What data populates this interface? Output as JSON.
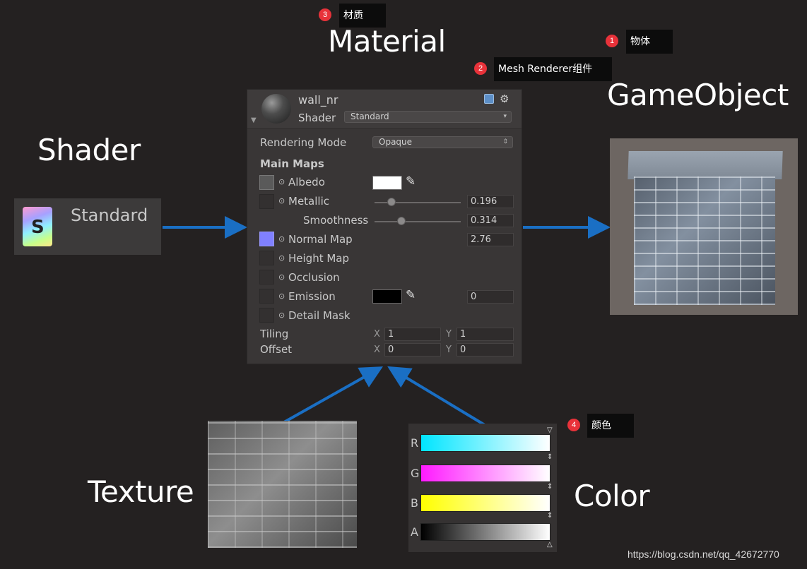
{
  "headings": {
    "material": "Material",
    "gameobject": "GameObject",
    "shader": "Shader",
    "texture": "Texture",
    "color": "Color"
  },
  "callouts": [
    {
      "num": "1",
      "text": "物体"
    },
    {
      "num": "2",
      "text": "Mesh Renderer组件"
    },
    {
      "num": "3",
      "text": "材质"
    },
    {
      "num": "4",
      "text": "颜色"
    }
  ],
  "shader_asset": {
    "icon_letter": "S",
    "name": "Standard"
  },
  "inspector": {
    "material_name": "wall_nr",
    "shader_label": "Shader",
    "shader_value": "Standard",
    "rendering_mode_label": "Rendering Mode",
    "rendering_mode_value": "Opaque",
    "main_maps_label": "Main Maps",
    "albedo_label": "Albedo",
    "metallic_label": "Metallic",
    "metallic_value": "0.196",
    "smoothness_label": "Smoothness",
    "smoothness_value": "0.314",
    "normal_map_label": "Normal Map",
    "normal_map_value": "2.76",
    "height_map_label": "Height Map",
    "occlusion_label": "Occlusion",
    "emission_label": "Emission",
    "emission_value": "0",
    "detail_mask_label": "Detail Mask",
    "tiling_label": "Tiling",
    "offset_label": "Offset",
    "x_label": "X",
    "y_label": "Y",
    "tiling_x": "1",
    "tiling_y": "1",
    "offset_x": "0",
    "offset_y": "0",
    "albedo_color": "#ffffff",
    "emission_color": "#000000",
    "normal_slot_color": "#8080ff"
  },
  "color_channels": [
    {
      "label": "R",
      "colors": [
        "#00e5ff",
        "#ffffff"
      ]
    },
    {
      "label": "G",
      "colors": [
        "#ff1aff",
        "#ffffff"
      ]
    },
    {
      "label": "B",
      "colors": [
        "#ffff00",
        "#ffffff"
      ]
    },
    {
      "label": "A",
      "colors": [
        "#000000",
        "#ffffff"
      ]
    }
  ],
  "arrow_color": "#1a6fc4",
  "badge_color": "#e8323a",
  "watermark": "https://blog.csdn.net/qq_42672770"
}
